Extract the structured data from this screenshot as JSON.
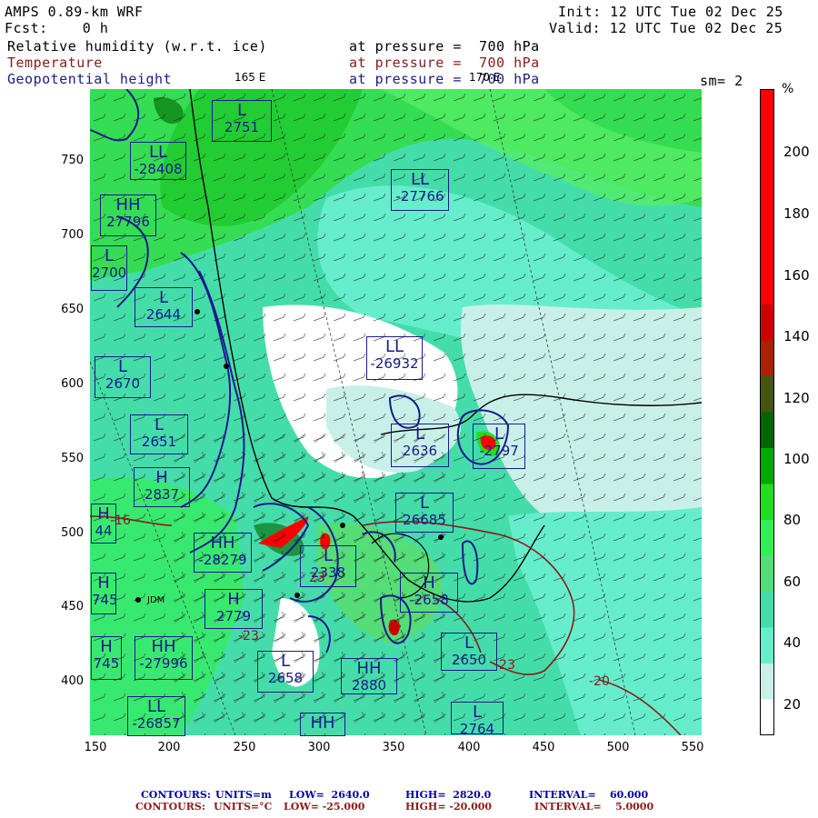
{
  "header": {
    "model": "AMPS 0.89-km WRF",
    "fcst": "Fcst:    0 h",
    "init": "Init: 12 UTC Tue 02 Dec 25",
    "valid": "Valid: 12 UTC Tue 02 Dec 25",
    "field1_name": "Relative humidity (w.r.t. ice)",
    "field1_level": "at pressure =  700 hPa",
    "field2_name": "Temperature",
    "field2_level": "at pressure =  700 hPa",
    "field3_name": "Geopotential height",
    "field3_level": "at pressure =  700 hPa",
    "smoothing": "sm= 2",
    "lon_label_1": "165 E",
    "lon_label_2": "170 E"
  },
  "axes": {
    "x_ticks": [
      "150",
      "200",
      "250",
      "300",
      "350",
      "400",
      "450",
      "500",
      "550"
    ],
    "y_ticks": [
      "750",
      "700",
      "650",
      "600",
      "550",
      "500",
      "450",
      "400"
    ]
  },
  "colorbar": {
    "unit": "%",
    "ticks": [
      "200",
      "180",
      "160",
      "140",
      "120",
      "100",
      "80",
      "60",
      "40",
      "20"
    ],
    "colors": [
      "#ff0000",
      "#ff0000",
      "#ff0000",
      "#ff0000",
      "#ff0000",
      "#ff0000",
      "#cc0000",
      "#aa2200",
      "#445511",
      "#006600",
      "#00aa00",
      "#22dd22",
      "#33ee55",
      "#55dd77",
      "#44ddaa",
      "#66eecc",
      "#c8f0e8",
      "#ffffff"
    ]
  },
  "labels": {
    "station": "JDM",
    "temp_neg16": "-16",
    "temp_neg20": "-20",
    "temp_neg23a": "-23",
    "temp_neg23b": "23",
    "temp_neg23c": "-23"
  },
  "highs_lows": [
    {
      "letter": "L",
      "value": "2751"
    },
    {
      "letter": "LL",
      "value": "-28408"
    },
    {
      "letter": "LL",
      "value": "-27766"
    },
    {
      "letter": "HH",
      "value": "27796"
    },
    {
      "letter": "L",
      "value": "2700"
    },
    {
      "letter": "L",
      "value": "2644"
    },
    {
      "letter": "LL",
      "value": "-26932"
    },
    {
      "letter": "L",
      "value": "2670"
    },
    {
      "letter": "L",
      "value": "2651"
    },
    {
      "letter": "L",
      "value": "2636"
    },
    {
      "letter": "L",
      "value": "-2797"
    },
    {
      "letter": "H",
      "value": "2837"
    },
    {
      "letter": "L",
      "value": "26685"
    },
    {
      "letter": "H",
      "value": "44"
    },
    {
      "letter": "HH",
      "value": "-28279"
    },
    {
      "letter": "L",
      "value": "2338"
    },
    {
      "letter": "H",
      "value": "-2658"
    },
    {
      "letter": "H",
      "value": "745"
    },
    {
      "letter": "H",
      "value": "2779"
    },
    {
      "letter": "L",
      "value": "2650"
    },
    {
      "letter": "H",
      "value": "745"
    },
    {
      "letter": "HH",
      "value": "-27996"
    },
    {
      "letter": "L",
      "value": "2658"
    },
    {
      "letter": "HH",
      "value": "2880"
    },
    {
      "letter": "LL",
      "value": "-26857"
    },
    {
      "letter": "L",
      "value": "2764"
    },
    {
      "letter": "HH",
      "value": ""
    }
  ],
  "footer": {
    "line1_label": "CONTOURS:",
    "line1_units": "UNITS=m",
    "line1_low": "LOW=  2640.0",
    "line1_high": "HIGH=  2820.0",
    "line1_interval": "INTERVAL=    60.000",
    "line2_label": "CONTOURS:",
    "line2_units": "UNITS=°C",
    "line2_low": "LOW= -25.000",
    "line2_high": "HIGH= -20.000",
    "line2_interval": "INTERVAL=    5.0000"
  }
}
